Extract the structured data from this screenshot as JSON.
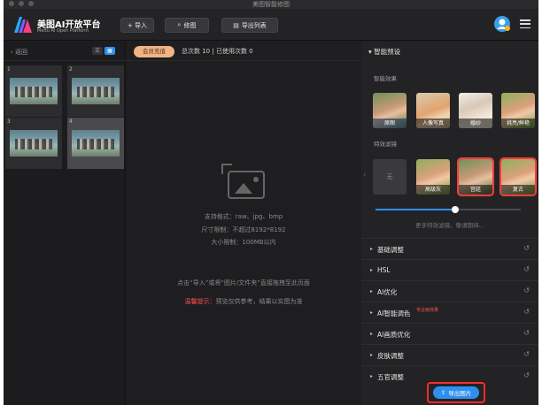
{
  "window": {
    "title": "美图智能修图"
  },
  "toolbar": {
    "logo_cn": "美图AI开放平台",
    "logo_en": "Meitu AI Open Platform",
    "import_label": "+ 导入",
    "retouch_label": "修图",
    "export_list_label": "导出列表"
  },
  "left": {
    "back_label": "返回",
    "thumbs": [
      "1",
      "2",
      "3",
      "4"
    ]
  },
  "center": {
    "member_badge": "会员充值",
    "counts": "总次数 10  |  已使用次数 0",
    "format_line": "支持格式：raw、jpg、bmp",
    "size_line": "尺寸限制：不超过8192*8192",
    "filesize_line": "大小限制：100MB以内",
    "drop_hint": "点击“导入”或将“图片/文件夹”直接拖拽至此页面",
    "warn_prefix": "温馨提示：",
    "warn_text": "预览仅供参考，结果以实图为准"
  },
  "right": {
    "section_title": "智能预设",
    "smart_effects_label": "智能效果",
    "presets": [
      "原图",
      "人像写真",
      "婚纱",
      "挑亮/鲜艳"
    ],
    "filters_label": "特效滤镜",
    "filters": [
      "无",
      "高级灰",
      "宫廷",
      "复古"
    ],
    "slider_value": 0.55,
    "more_filters": "更多特效滤镜，敬请期待...",
    "accordion": [
      {
        "label": "基础调整"
      },
      {
        "label": "HSL"
      },
      {
        "label": "AI优化"
      },
      {
        "label": "AI智能调色",
        "tag": "专业级效果"
      },
      {
        "label": "AI画质优化"
      },
      {
        "label": "皮肤调整"
      },
      {
        "label": "五官调整"
      }
    ],
    "export_label": "导出图片"
  }
}
